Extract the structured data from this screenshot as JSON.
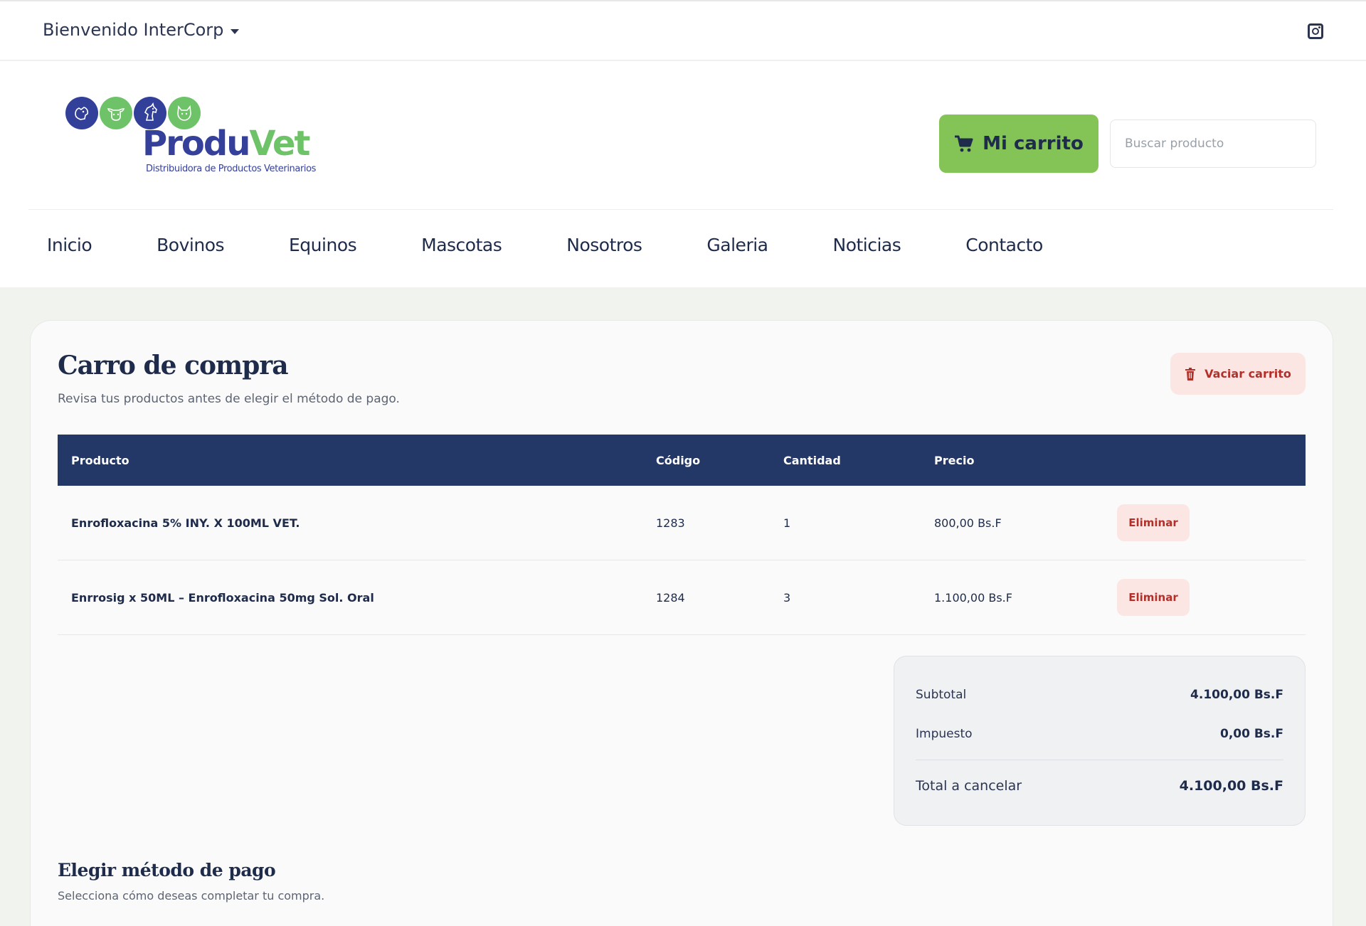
{
  "topbar": {
    "welcome": "Bienvenido InterCorp"
  },
  "header": {
    "logo": {
      "brand_part1": "Produ",
      "brand_part2": "Vet",
      "tagline": "Distribuidora de Productos Veterinarios"
    },
    "cart_label": "Mi carrito",
    "search_placeholder": "Buscar producto"
  },
  "nav": [
    "Inicio",
    "Bovinos",
    "Equinos",
    "Mascotas",
    "Nosotros",
    "Galeria",
    "Noticias",
    "Contacto"
  ],
  "cart": {
    "title": "Carro de compra",
    "subtitle": "Revisa tus productos antes de elegir el método de pago.",
    "empty_label": "Vaciar carrito",
    "columns": [
      "Producto",
      "Código",
      "Cantidad",
      "Precio"
    ],
    "items": [
      {
        "product": "Enrofloxacina 5% INY. X 100ML VET.",
        "code": "1283",
        "qty": "1",
        "price": "800,00 Bs.F",
        "action": "Eliminar"
      },
      {
        "product": "Enrrosig x 50ML – Enrofloxacina 50mg Sol. Oral",
        "code": "1284",
        "qty": "3",
        "price": "1.100,00 Bs.F",
        "action": "Eliminar"
      }
    ],
    "summary": {
      "subtotal_label": "Subtotal",
      "subtotal_value": "4.100,00 Bs.F",
      "tax_label": "Impuesto",
      "tax_value": "0,00 Bs.F",
      "total_label": "Total a cancelar",
      "total_value": "4.100,00 Bs.F"
    },
    "payment": {
      "title": "Elegir método de pago",
      "subtitle": "Selecciona cómo deseas completar tu compra."
    }
  },
  "colors": {
    "navy": "#233867",
    "green": "#84c356",
    "danger": "#b3302a",
    "danger_bg": "#fbe6e4",
    "brand_blue": "#35409a",
    "brand_green": "#6ec369"
  }
}
